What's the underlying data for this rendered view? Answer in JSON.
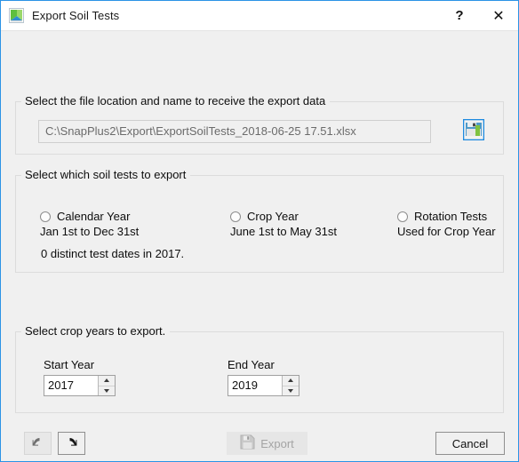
{
  "window": {
    "title": "Export Soil Tests",
    "icon": "snapplus-app-icon",
    "help_label": "?",
    "close_label": "✕",
    "border_color": "#2b93e6"
  },
  "file_group": {
    "legend": "Select the file location and name to receive the export data",
    "path_value": "C:\\SnapPlus2\\Export\\ExportSoilTests_2018-06-25 17.51.xlsx",
    "path_placeholder": "",
    "browse_icon": "save-floppy-icon"
  },
  "tests_group": {
    "legend": "Select which soil tests to export",
    "options": [
      {
        "label": "Calendar Year",
        "sublabel": "Jan 1st to Dec 31st",
        "selected": false
      },
      {
        "label": "Crop Year",
        "sublabel": "June 1st to May 31st",
        "selected": false
      },
      {
        "label": "Rotation Tests",
        "sublabel": "Used for Crop Year",
        "selected": false
      }
    ],
    "note": "0 distinct test dates in 2017."
  },
  "years_group": {
    "legend": "Select crop years to export.",
    "start": {
      "label": "Start Year",
      "value": "2017"
    },
    "end": {
      "label": "End Year",
      "value": "2019"
    }
  },
  "footer": {
    "back_icon": "arrow-left-icon",
    "forward_icon": "arrow-right-icon",
    "export_label": "Export",
    "export_icon": "save-floppy-icon",
    "export_disabled": true,
    "cancel_label": "Cancel"
  }
}
